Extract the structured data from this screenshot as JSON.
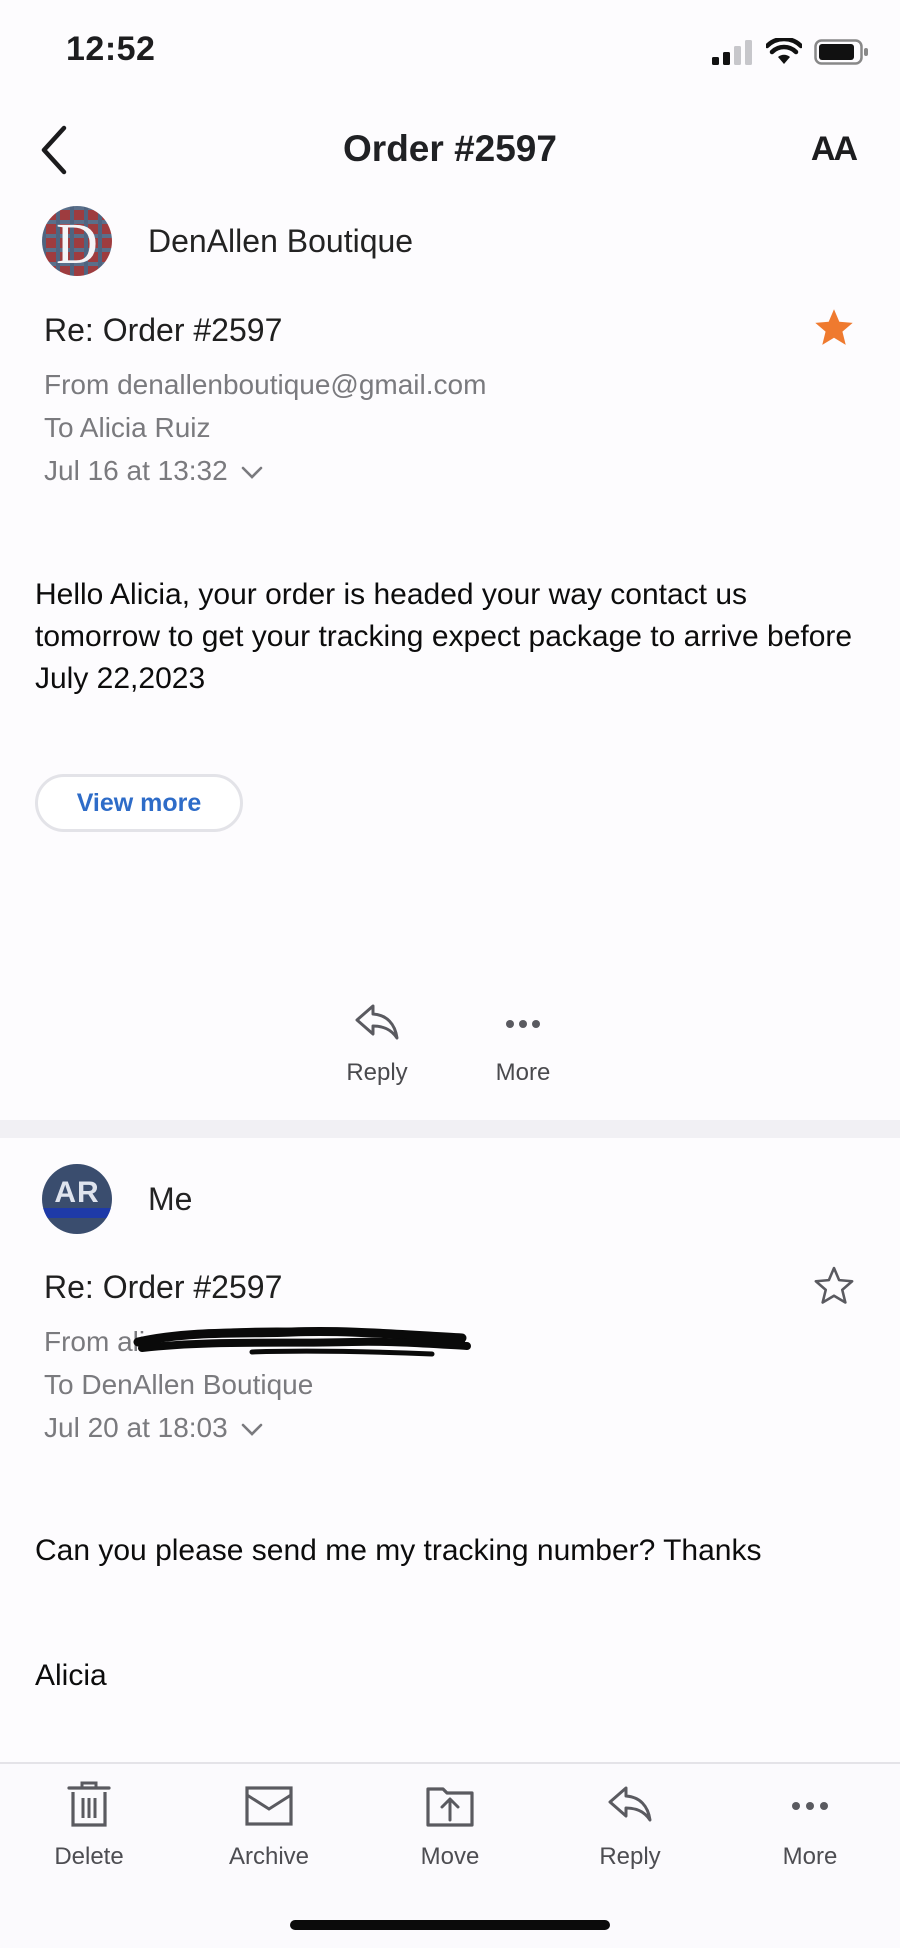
{
  "status_bar": {
    "time": "12:52"
  },
  "nav": {
    "title": "Order #2597",
    "text_size_label": "AA"
  },
  "messages": [
    {
      "sender": "DenAllen Boutique",
      "avatar_letter": "D",
      "subject": "Re: Order #2597",
      "from": "From denallenboutique@gmail.com",
      "to": "To Alicia Ruiz",
      "date": "Jul 16 at 13:32",
      "starred": true,
      "body": "Hello Alicia, your order is headed your way contact us tomorrow to get your tracking expect package to arrive before July 22,2023",
      "view_more": "View more",
      "actions": {
        "reply": "Reply",
        "more": "More"
      }
    },
    {
      "sender": "Me",
      "avatar_letter": "AR",
      "subject": "Re: Order #2597",
      "from": "From ali",
      "to": "To DenAllen Boutique",
      "date": "Jul 20 at 18:03",
      "starred": false,
      "body": "Can you please send me my tracking number? Thanks",
      "signature": "Alicia"
    }
  ],
  "toolbar": {
    "delete": "Delete",
    "archive": "Archive",
    "move": "Move",
    "reply": "Reply",
    "more": "More"
  },
  "colors": {
    "star_active": "#ef7a2f",
    "link": "#2e6cc8",
    "icon": "#5a5a60"
  }
}
